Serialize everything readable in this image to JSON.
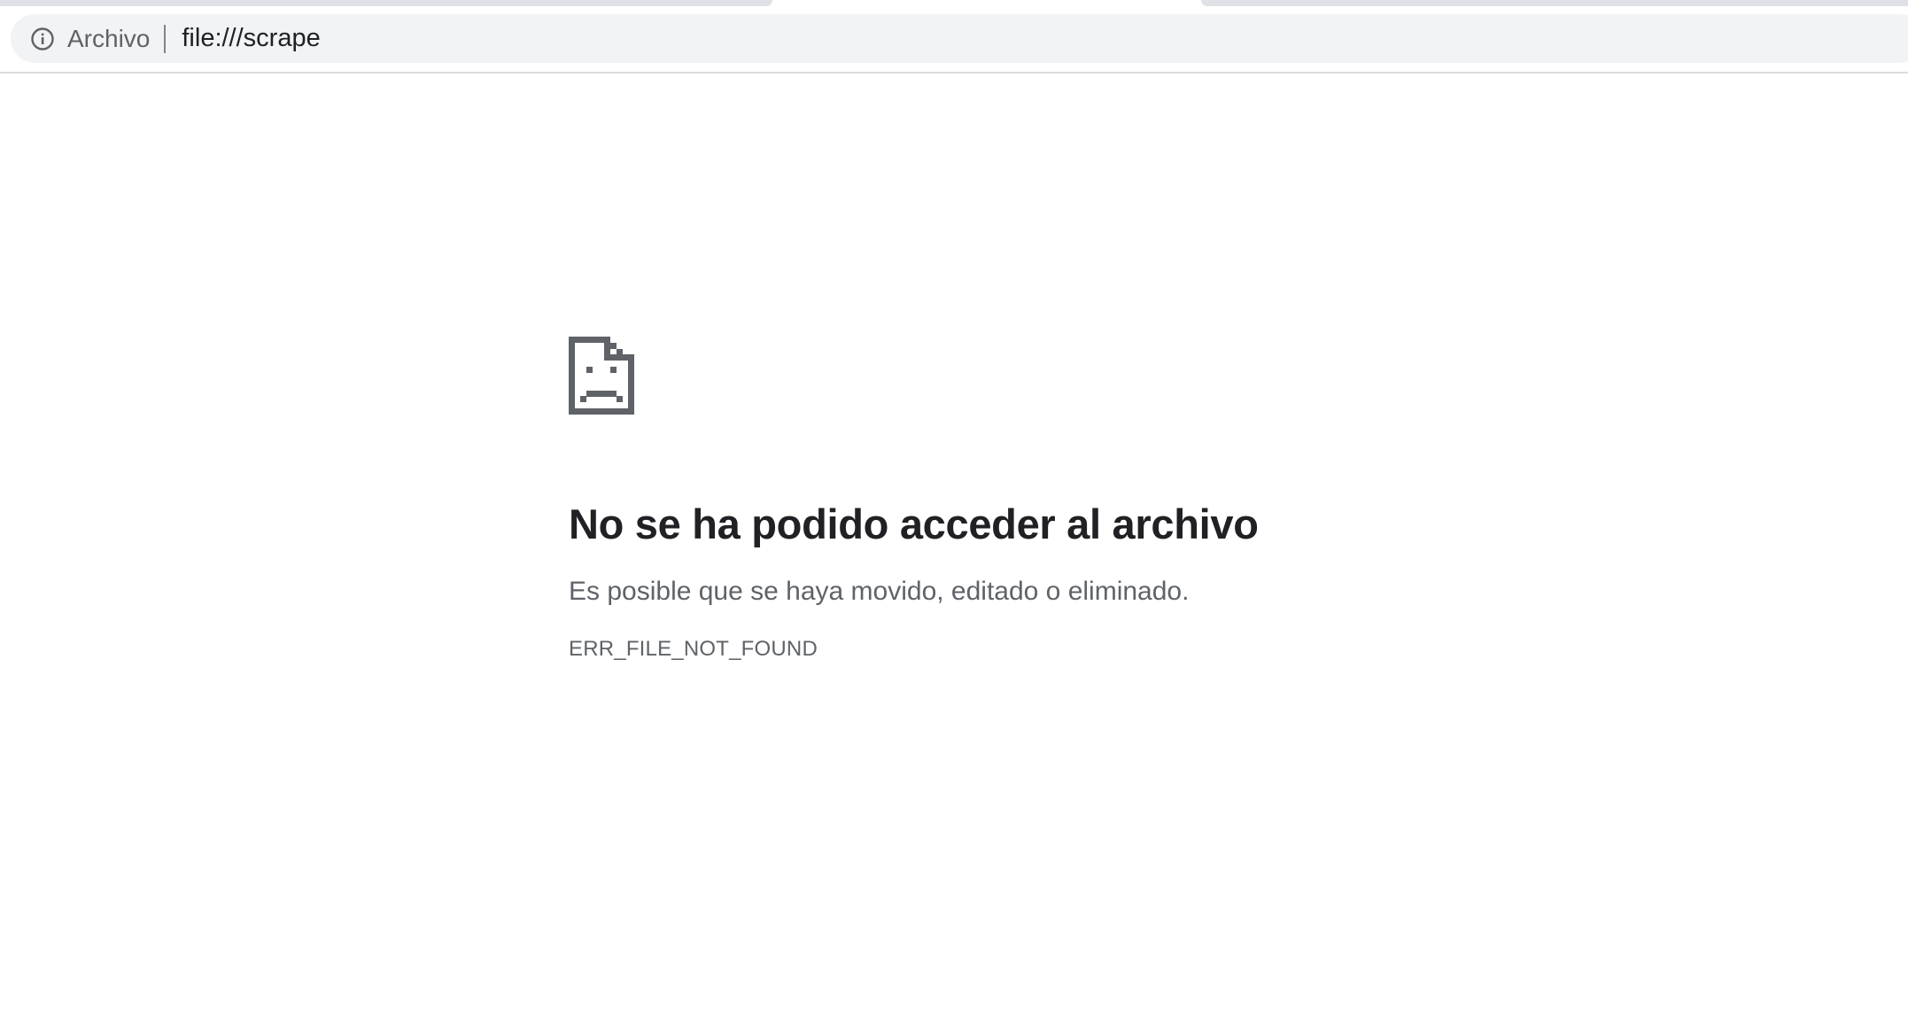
{
  "omnibox": {
    "security_icon": "info-icon",
    "security_label": "Archivo",
    "url": "file:///scrape"
  },
  "error_page": {
    "icon": "sad-file-icon",
    "title": "No se ha podido acceder al archivo",
    "description": "Es posible que se haya movido, editado o eliminado.",
    "code": "ERR_FILE_NOT_FOUND"
  },
  "colors": {
    "tab_strip": "#dee1e6",
    "omnibox_bg": "#f1f3f4",
    "title_text": "#202124",
    "secondary_text": "#5f6368",
    "icon_color": "#5f6368"
  }
}
